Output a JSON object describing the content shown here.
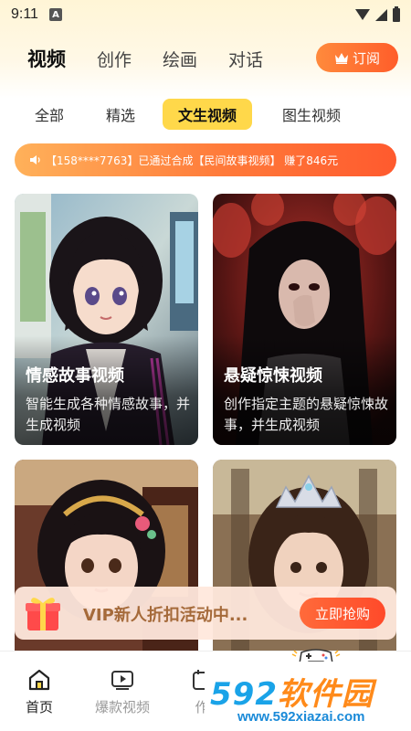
{
  "status_bar": {
    "time": "9:11",
    "indicator": "A"
  },
  "header": {
    "tabs": [
      "视频",
      "创作",
      "绘画",
      "对话"
    ],
    "active_tab": "视频",
    "subscribe_label": "订阅"
  },
  "sub_tabs": {
    "items": [
      "全部",
      "精选",
      "文生视频",
      "图生视频"
    ],
    "active": "文生视频"
  },
  "announcement": {
    "text": "【158****7763】已通过合成【民间故事视频】 赚了846元"
  },
  "cards": [
    {
      "title": "情感故事视频",
      "desc": "智能生成各种情感故事，并生成视频"
    },
    {
      "title": "悬疑惊悚视频",
      "desc": "创作指定主题的悬疑惊悚故事，并生成视频"
    },
    {
      "title": "",
      "desc": ""
    },
    {
      "title": "",
      "desc": ""
    }
  ],
  "vip_banner": {
    "text": "VIP新人折扣活动中...",
    "button": "立即抢购"
  },
  "bottom_nav": {
    "items": [
      {
        "label": "首页",
        "icon": "home-icon"
      },
      {
        "label": "爆款视频",
        "icon": "video-play-icon"
      },
      {
        "label": "作",
        "icon": "works-icon"
      }
    ],
    "active": "首页"
  },
  "watermark": {
    "logo_num": "592",
    "logo_cn": "软件园",
    "url": "www.592xiazai.com"
  },
  "colors": {
    "accent_yellow": "#ffd84a",
    "accent_orange": "#ff5d2a",
    "vip_text": "#a56a3a"
  }
}
